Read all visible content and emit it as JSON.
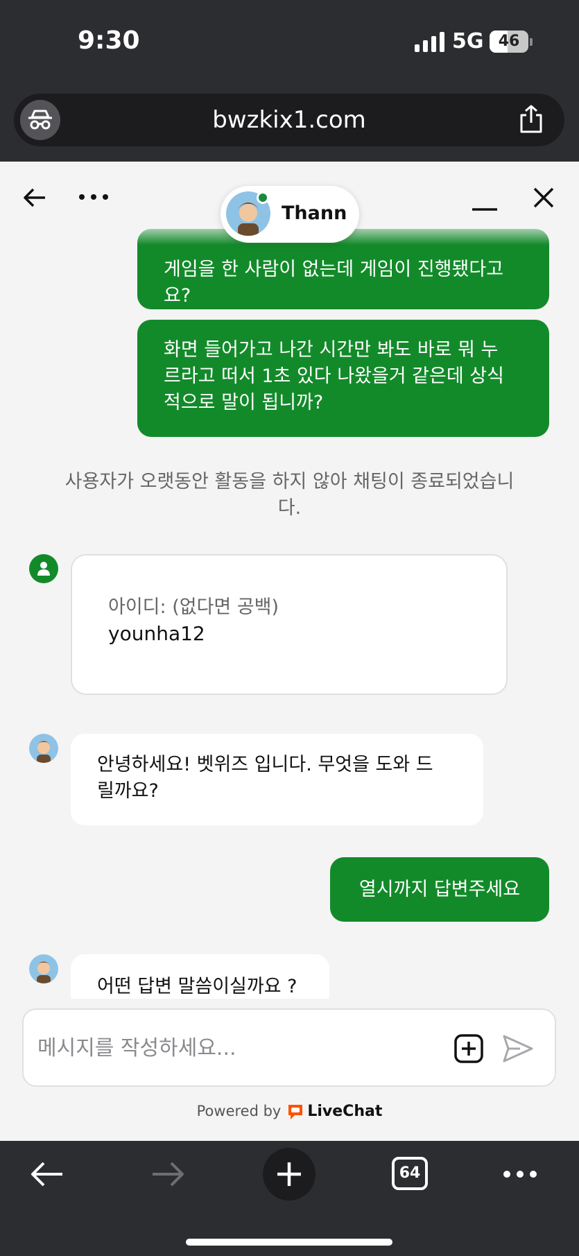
{
  "status_bar": {
    "time": "9:30",
    "network": "5G",
    "battery": "46"
  },
  "browser": {
    "url": "bwzkix1.com",
    "tab_count": "64"
  },
  "chat_header": {
    "agent_name": "Thann"
  },
  "messages": {
    "out_1": "게임을 한 사람이 없는데 게임이 진행됐다고\n요?",
    "out_2": "화면 들어가고 나간 시간만 봐도 바로 뭐 누\n르라고 떠서 1초 있다 나왔을거 같은데 상식\n적으로 말이 됩니까?",
    "system": "사용자가 오랫동안 활동을 하지 않아 채팅이 종료되었습니\n다.",
    "form_label": "아이디: (없다면 공백)",
    "form_value": "younha12",
    "in_1": "안녕하세요! 벳위즈 입니다. 무엇을 도와 드\n릴까요?",
    "out_3": "열시까지 답변주세요",
    "in_2": "어떤 답변 말씀이실까요 ?"
  },
  "composer": {
    "placeholder": "메시지를 작성하세요..."
  },
  "footer": {
    "powered_by": "Powered by",
    "brand": "LiveChat"
  },
  "colors": {
    "accent": "#138a2a",
    "chrome": "#2c2d30",
    "background": "#f4f4f5"
  }
}
